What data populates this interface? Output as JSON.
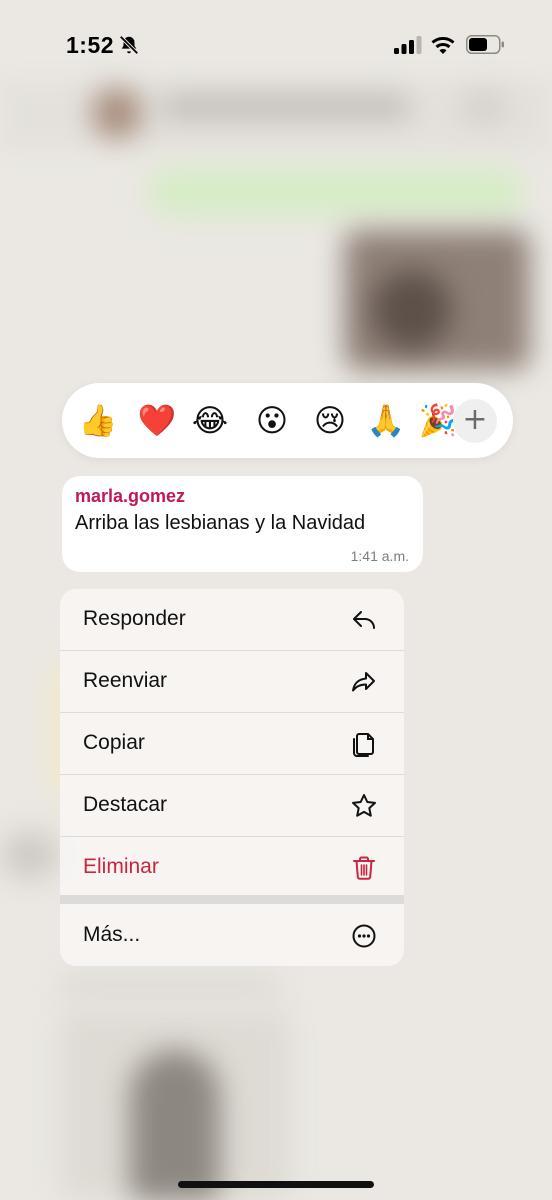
{
  "status_bar": {
    "time": "1:52",
    "icons": [
      "bell-off-icon",
      "cellular-signal-icon",
      "wifi-icon",
      "battery-icon"
    ]
  },
  "reactions": {
    "items": [
      "👍",
      "❤️",
      "😂",
      "😮",
      "😢",
      "🙏",
      "🎉"
    ],
    "more_label": "+"
  },
  "message": {
    "sender": "marla.gomez",
    "text": "Arriba las lesbianas y la Navidad",
    "time": "1:41 a.m."
  },
  "menu": {
    "items": [
      {
        "label": "Responder",
        "icon": "reply-icon"
      },
      {
        "label": "Reenviar",
        "icon": "forward-icon"
      },
      {
        "label": "Copiar",
        "icon": "copy-icon"
      },
      {
        "label": "Destacar",
        "icon": "star-icon"
      },
      {
        "label": "Eliminar",
        "icon": "trash-icon"
      },
      {
        "label": "Más...",
        "icon": "more-icon"
      }
    ]
  },
  "colors": {
    "sender": "#c2185b",
    "danger": "#c8263e",
    "menu_bg": "#f7f5f2"
  }
}
